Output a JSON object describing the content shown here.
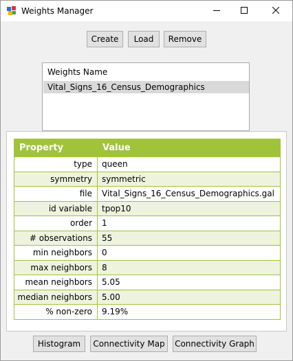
{
  "window": {
    "title": "Weights Manager",
    "app_icon": "geoda-icon",
    "controls": [
      "minimize-icon",
      "maximize-icon",
      "close-icon"
    ]
  },
  "toolbar": {
    "create_label": "Create",
    "load_label": "Load",
    "remove_label": "Remove"
  },
  "weights_list": {
    "header": "Weights Name",
    "items": [
      "Vital_Signs_16_Census_Demographics"
    ],
    "selected_index": 0
  },
  "properties": {
    "headers": [
      "Property",
      "Value"
    ],
    "rows": [
      {
        "key": "type",
        "value": "queen"
      },
      {
        "key": "symmetry",
        "value": "symmetric"
      },
      {
        "key": "file",
        "value": "Vital_Signs_16_Census_Demographics.gal"
      },
      {
        "key": "id variable",
        "value": "tpop10"
      },
      {
        "key": "order",
        "value": "1"
      },
      {
        "key": "# observations",
        "value": "55"
      },
      {
        "key": "min neighbors",
        "value": "0"
      },
      {
        "key": "max neighbors",
        "value": "8"
      },
      {
        "key": "mean neighbors",
        "value": "5.05"
      },
      {
        "key": "median neighbors",
        "value": "5.00"
      },
      {
        "key": "% non-zero",
        "value": "9.19%"
      }
    ]
  },
  "footer": {
    "histogram_label": "Histogram",
    "connectivity_map_label": "Connectivity Map",
    "connectivity_graph_label": "Connectivity Graph"
  },
  "colors": {
    "header_green": "#a0c33a",
    "row_alt": "#eef3de",
    "selection": "#d9d9d9"
  }
}
